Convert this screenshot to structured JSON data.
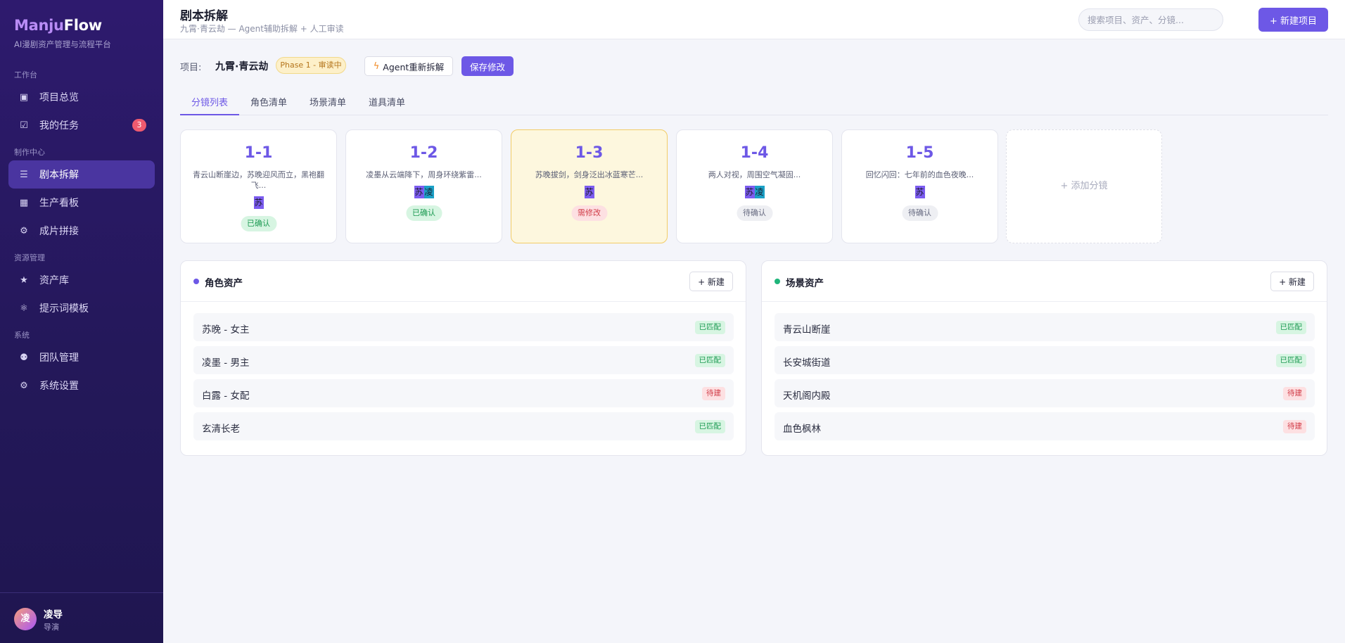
{
  "app": {
    "logo_part1": "Manju",
    "logo_part2": "Flow",
    "tagline": "AI漫剧资产管理与流程平台"
  },
  "sidebar": {
    "sections": [
      {
        "label": "工作台"
      },
      {
        "label": "制作中心"
      },
      {
        "label": "资源管理"
      },
      {
        "label": "系统"
      }
    ],
    "items": [
      {
        "label": "项目总览",
        "icon": "dashboard-icon"
      },
      {
        "label": "我的任务",
        "icon": "checkbox-icon",
        "badge": "3"
      },
      {
        "label": "剧本拆解",
        "icon": "list-icon",
        "active": true
      },
      {
        "label": "生产看板",
        "icon": "grid-icon"
      },
      {
        "label": "成片拼接",
        "icon": "gear-icon"
      },
      {
        "label": "资产库",
        "icon": "star-icon"
      },
      {
        "label": "提示词模板",
        "icon": "atom-icon"
      },
      {
        "label": "团队管理",
        "icon": "team-icon"
      },
      {
        "label": "系统设置",
        "icon": "gear-icon"
      }
    ],
    "user": {
      "avatar_text": "凌",
      "name": "凌导",
      "role": "导演"
    }
  },
  "header": {
    "title": "剧本拆解",
    "subtitle": "九霄·青云劫 — Agent辅助拆解 + 人工审读",
    "search_placeholder": "搜索项目、资产、分镜...",
    "new_project_label": "+ 新建项目"
  },
  "project": {
    "label": "项目:",
    "name": "九霄·青云劫",
    "phase": "Phase 1 - 审读中",
    "agent_button": "Agent重新拆解",
    "save_button": "保存修改"
  },
  "tabs": [
    {
      "label": "分镜列表",
      "active": true
    },
    {
      "label": "角色清单"
    },
    {
      "label": "场景清单"
    },
    {
      "label": "道具清单"
    }
  ],
  "shots": [
    {
      "id": "1-1",
      "desc": "青云山断崖边，苏晚迎风而立，黑袍翻飞...",
      "chars": [
        "苏"
      ],
      "status": "已确认",
      "status_type": "ok"
    },
    {
      "id": "1-2",
      "desc": "凌墨从云端降下，周身环绕紫雷...",
      "chars": [
        "苏",
        "凌"
      ],
      "status": "已确认",
      "status_type": "ok"
    },
    {
      "id": "1-3",
      "desc": "苏晚拔剑，剑身泛出冰蓝寒芒...",
      "chars": [
        "苏"
      ],
      "status": "需修改",
      "status_type": "bad"
    },
    {
      "id": "1-4",
      "desc": "两人对视，周围空气凝固...",
      "chars": [
        "苏",
        "凌"
      ],
      "status": "待确认",
      "status_type": "wait"
    },
    {
      "id": "1-5",
      "desc": "回忆闪回：七年前的血色夜晚...",
      "chars": [
        "苏"
      ],
      "status": "待确认",
      "status_type": "wait"
    }
  ],
  "add_shot_label": "+ 添加分镜",
  "character_panel": {
    "title": "角色资产",
    "new_label": "+ 新建",
    "dot_color": "#6d58e6",
    "rows": [
      {
        "name": "苏晚 - 女主",
        "tag": "已匹配",
        "tag_type": "ok"
      },
      {
        "name": "凌墨 - 男主",
        "tag": "已匹配",
        "tag_type": "ok"
      },
      {
        "name": "白露 - 女配",
        "tag": "待建",
        "tag_type": "pending"
      },
      {
        "name": "玄清长老",
        "tag": "已匹配",
        "tag_type": "ok"
      }
    ]
  },
  "scene_panel": {
    "title": "场景资产",
    "new_label": "+ 新建",
    "dot_color": "#1fb57a",
    "rows": [
      {
        "name": "青云山断崖",
        "tag": "已匹配",
        "tag_type": "ok"
      },
      {
        "name": "长安城街道",
        "tag": "已匹配",
        "tag_type": "ok"
      },
      {
        "name": "天机阁内殿",
        "tag": "待建",
        "tag_type": "pending"
      },
      {
        "name": "血色枫林",
        "tag": "待建",
        "tag_type": "pending"
      }
    ]
  }
}
